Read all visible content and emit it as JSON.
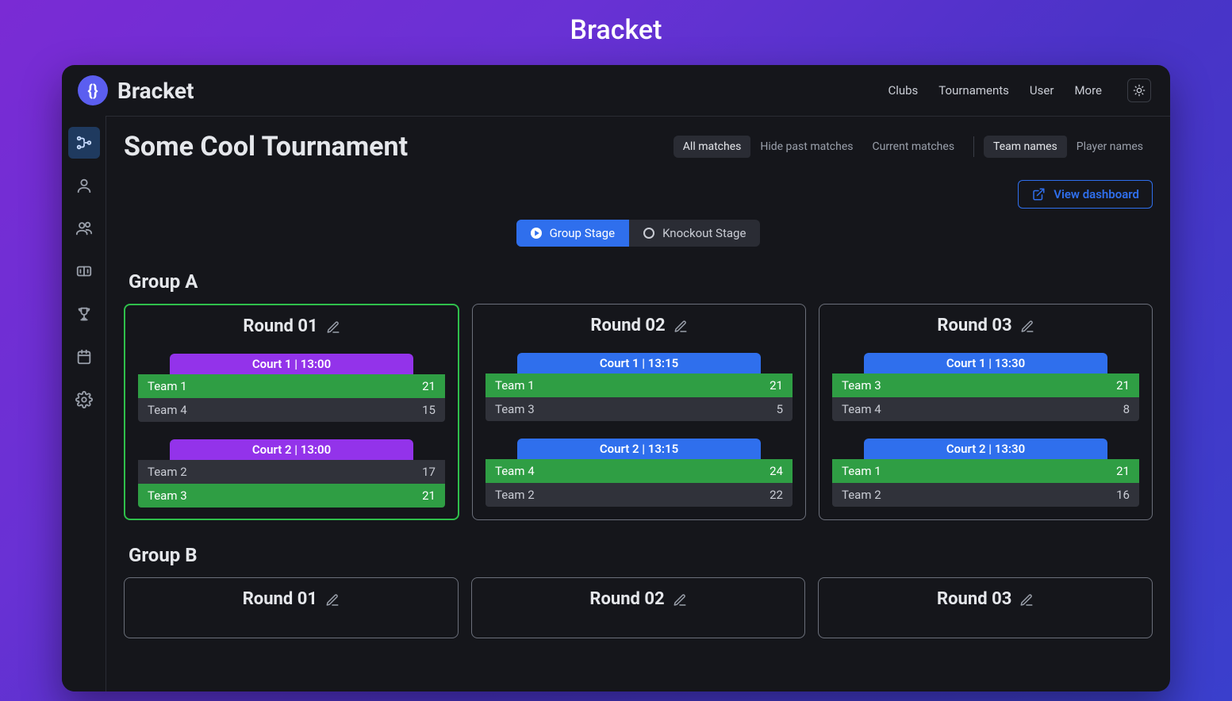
{
  "page_heading": "Bracket",
  "brand": {
    "name": "Bracket",
    "logo_glyph": "{}"
  },
  "topnav": {
    "clubs": "Clubs",
    "tournaments": "Tournaments",
    "user": "User",
    "more": "More"
  },
  "sidebar": {
    "items": [
      {
        "name": "bracket-icon",
        "active": true
      },
      {
        "name": "user-icon",
        "active": false
      },
      {
        "name": "users-icon",
        "active": false
      },
      {
        "name": "scoreboard-icon",
        "active": false
      },
      {
        "name": "trophy-icon",
        "active": false
      },
      {
        "name": "calendar-icon",
        "active": false
      },
      {
        "name": "settings-icon",
        "active": false
      }
    ]
  },
  "tournament": {
    "title": "Some Cool Tournament"
  },
  "filters": {
    "matches": {
      "all": "All matches",
      "hide_past": "Hide past matches",
      "current": "Current matches",
      "active": "all"
    },
    "names": {
      "team": "Team names",
      "player": "Player names",
      "active": "team"
    }
  },
  "dashboard_button": "View dashboard",
  "stages": {
    "group": "Group Stage",
    "knockout": "Knockout Stage",
    "active": "group"
  },
  "groups": [
    {
      "title": "Group A",
      "rounds": [
        {
          "title": "Round 01",
          "active": true,
          "tab_color": "purple",
          "matches": [
            {
              "court": "Court 1 | 13:00",
              "t1": "Team 1",
              "s1": "21",
              "t2": "Team 4",
              "s2": "15",
              "winner": 1
            },
            {
              "court": "Court 2 | 13:00",
              "t1": "Team 2",
              "s1": "17",
              "t2": "Team 3",
              "s2": "21",
              "winner": 2
            }
          ]
        },
        {
          "title": "Round 02",
          "active": false,
          "tab_color": "blue",
          "matches": [
            {
              "court": "Court 1 | 13:15",
              "t1": "Team 1",
              "s1": "21",
              "t2": "Team 3",
              "s2": "5",
              "winner": 1
            },
            {
              "court": "Court 2 | 13:15",
              "t1": "Team 4",
              "s1": "24",
              "t2": "Team 2",
              "s2": "22",
              "winner": 1
            }
          ]
        },
        {
          "title": "Round 03",
          "active": false,
          "tab_color": "blue",
          "matches": [
            {
              "court": "Court 1 | 13:30",
              "t1": "Team 3",
              "s1": "21",
              "t2": "Team 4",
              "s2": "8",
              "winner": 1
            },
            {
              "court": "Court 2 | 13:30",
              "t1": "Team 1",
              "s1": "21",
              "t2": "Team 2",
              "s2": "16",
              "winner": 1
            }
          ]
        }
      ]
    },
    {
      "title": "Group B",
      "rounds": [
        {
          "title": "Round 01",
          "active": false,
          "tab_color": "blue",
          "matches": []
        },
        {
          "title": "Round 02",
          "active": false,
          "tab_color": "blue",
          "matches": []
        },
        {
          "title": "Round 03",
          "active": false,
          "tab_color": "blue",
          "matches": []
        }
      ]
    }
  ]
}
